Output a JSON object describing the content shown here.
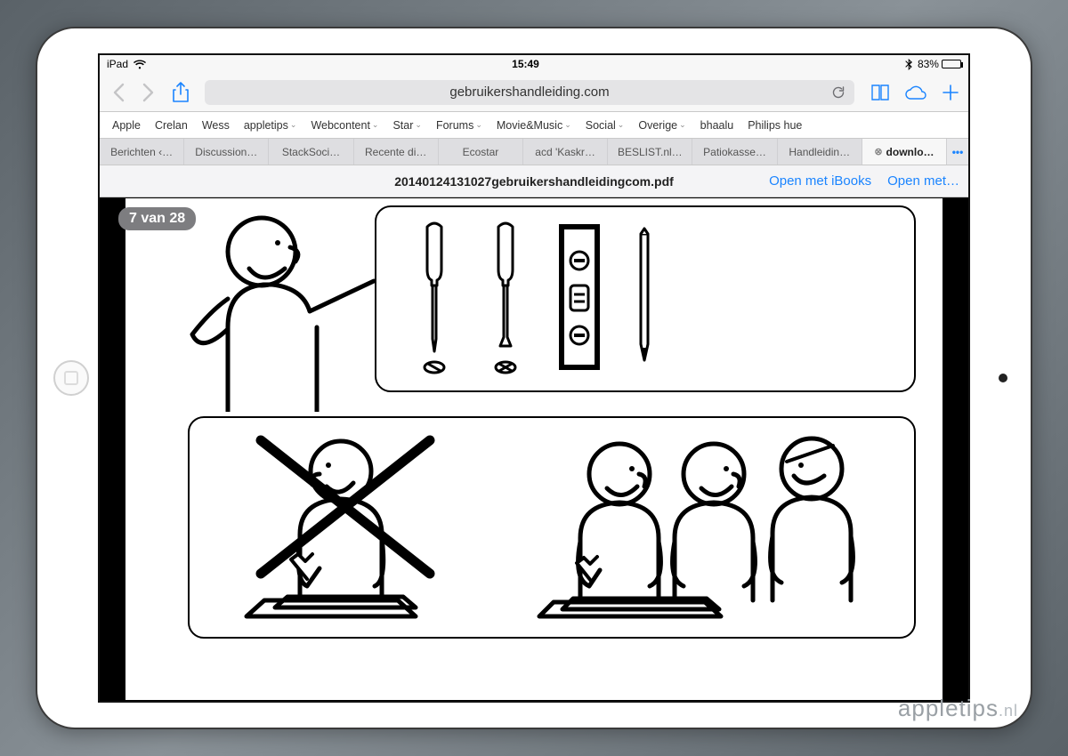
{
  "statusbar": {
    "carrier": "iPad",
    "time": "15:49",
    "battery_pct": "83%"
  },
  "toolbar": {
    "url_display": "gebruikershandleiding.com"
  },
  "bookmarks": [
    {
      "label": "Apple",
      "dropdown": false
    },
    {
      "label": "Crelan",
      "dropdown": false
    },
    {
      "label": "Wess",
      "dropdown": false
    },
    {
      "label": "appletips",
      "dropdown": true
    },
    {
      "label": "Webcontent",
      "dropdown": true
    },
    {
      "label": "Star",
      "dropdown": true
    },
    {
      "label": "Forums",
      "dropdown": true
    },
    {
      "label": "Movie&Music",
      "dropdown": true
    },
    {
      "label": "Social",
      "dropdown": true
    },
    {
      "label": "Overige",
      "dropdown": true
    },
    {
      "label": "bhaalu",
      "dropdown": false
    },
    {
      "label": "Philips hue",
      "dropdown": false
    }
  ],
  "tabs": [
    {
      "label": "Berichten ‹…"
    },
    {
      "label": "Discussion…"
    },
    {
      "label": "StackSoci…"
    },
    {
      "label": "Recente di…"
    },
    {
      "label": "Ecostar"
    },
    {
      "label": "acd 'Kaskr…"
    },
    {
      "label": "BESLIST.nl…"
    },
    {
      "label": "Patiokasse…"
    },
    {
      "label": "Handleidin…"
    },
    {
      "label": "downlo…",
      "active": true,
      "closable": true
    }
  ],
  "pdfbar": {
    "filename": "20140124131027gebruikershandleidingcom.pdf",
    "open_ibooks": "Open met iBooks",
    "open_with": "Open met…"
  },
  "page_indicator": "7 van 28",
  "watermark": {
    "brand": "appletips",
    "tld": ".nl"
  }
}
